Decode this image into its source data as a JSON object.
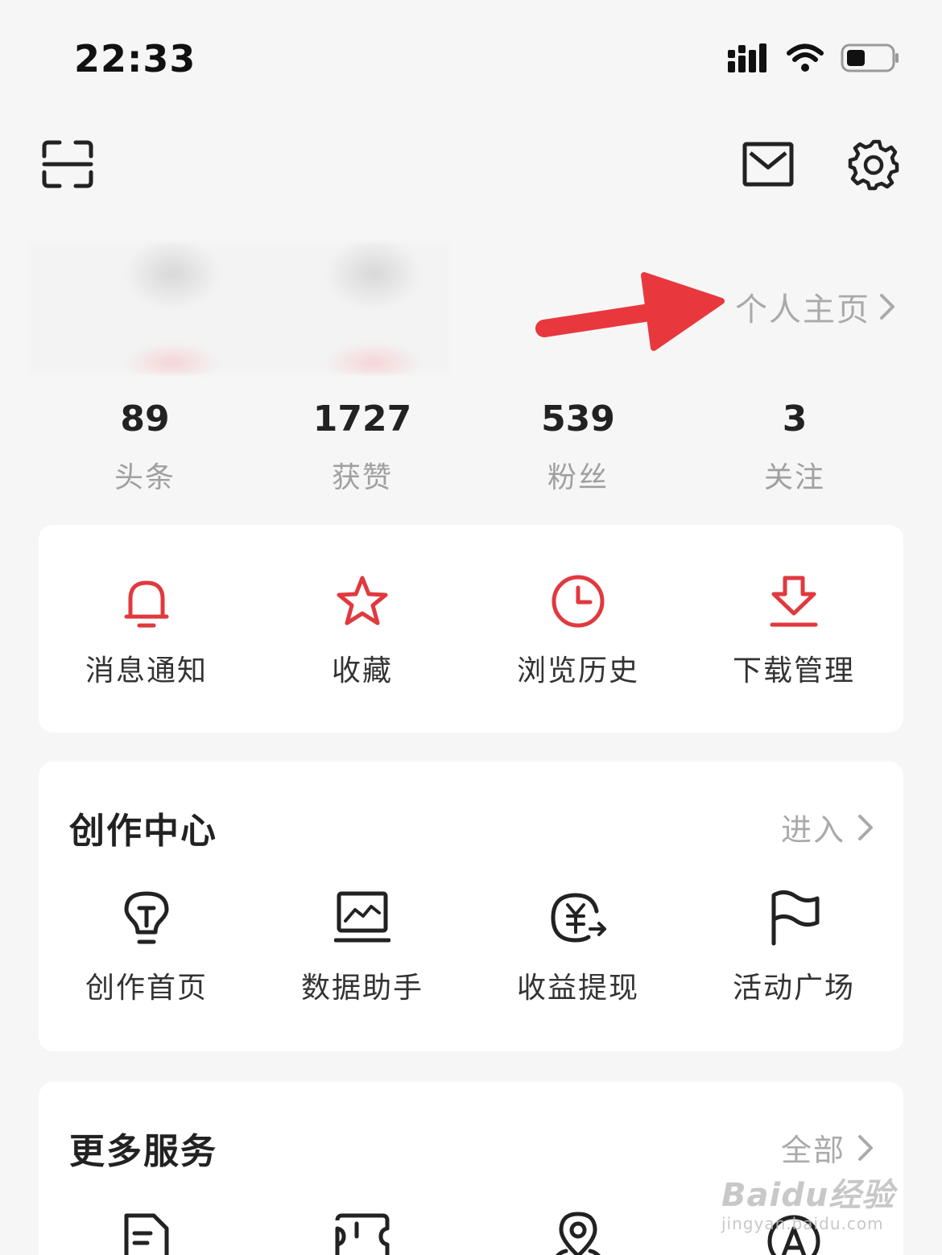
{
  "status_bar": {
    "time": "22:33",
    "icons": [
      "signal-icon",
      "wifi-icon",
      "battery-icon"
    ]
  },
  "top_bar": {
    "icons": [
      "scan-icon",
      "mail-icon",
      "gear-icon"
    ]
  },
  "profile": {
    "homepage_label": "个人主页"
  },
  "stats": [
    {
      "value": "89",
      "label": "头条"
    },
    {
      "value": "1727",
      "label": "获赞"
    },
    {
      "value": "539",
      "label": "粉丝"
    },
    {
      "value": "3",
      "label": "关注"
    }
  ],
  "quick_actions": [
    {
      "label": "消息通知",
      "icon": "bell-icon"
    },
    {
      "label": "收藏",
      "icon": "star-icon"
    },
    {
      "label": "浏览历史",
      "icon": "clock-icon"
    },
    {
      "label": "下载管理",
      "icon": "download-icon"
    }
  ],
  "creation_center": {
    "title": "创作中心",
    "link_label": "进入",
    "items": [
      {
        "label": "创作首页",
        "icon": "lightbulb-icon"
      },
      {
        "label": "数据助手",
        "icon": "chart-monitor-icon"
      },
      {
        "label": "收益提现",
        "icon": "yen-withdraw-icon"
      },
      {
        "label": "活动广场",
        "icon": "flag-icon"
      }
    ]
  },
  "more_services": {
    "title": "更多服务",
    "link_label": "全部",
    "items": [
      "document-icon",
      "ticket-icon",
      "location-icon",
      "ad-icon"
    ]
  },
  "accent_color": "#e0393e",
  "watermark": {
    "brand": "Baidu经验",
    "url": "jingyan.baidu.com"
  }
}
